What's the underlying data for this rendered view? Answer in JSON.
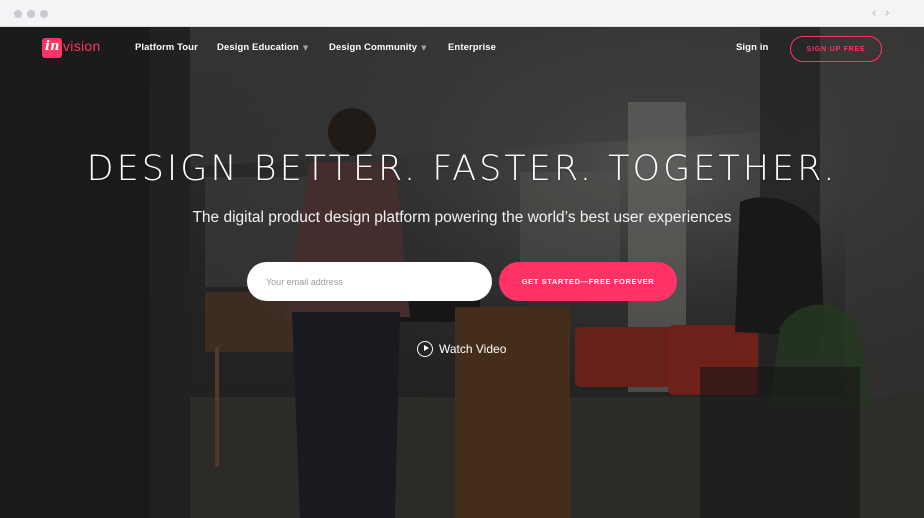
{
  "brand": {
    "logo_mark": "in",
    "logo_word": "vision",
    "accent": "#ff3366"
  },
  "nav": {
    "items": [
      {
        "label": "Platform Tour",
        "has_dropdown": false
      },
      {
        "label": "Design Education",
        "has_dropdown": true
      },
      {
        "label": "Design Community",
        "has_dropdown": true
      },
      {
        "label": "Enterprise",
        "has_dropdown": false
      }
    ],
    "sign_in": "Sign in",
    "sign_up": "SIGN UP FREE",
    "caret_icon": "chevron-down-icon"
  },
  "hero": {
    "title": "DESIGN BETTER. FASTER. TOGETHER.",
    "subtitle": "The digital product design platform powering the world’s best user experiences",
    "email_placeholder": "Your email address",
    "email_value": "",
    "cta": "GET STARTED—FREE FOREVER",
    "watch_video": "Watch Video",
    "play_icon": "play-circle-icon"
  },
  "browser": {
    "back_icon": "chevron-left-icon",
    "forward_icon": "chevron-right-icon"
  }
}
